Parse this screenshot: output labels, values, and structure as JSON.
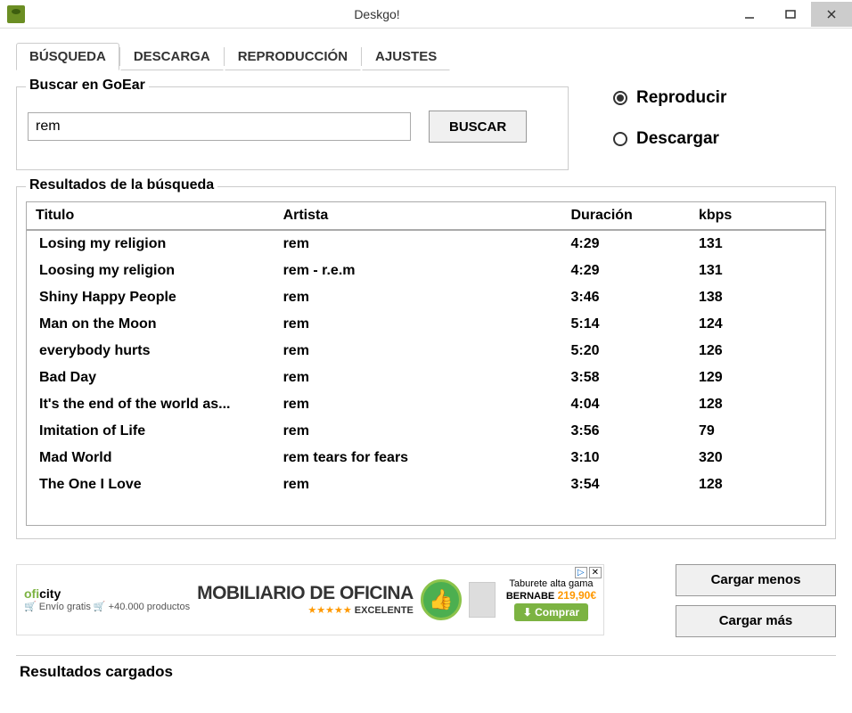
{
  "window": {
    "title": "Deskgo!"
  },
  "tabs": [
    "BÚSQUEDA",
    "DESCARGA",
    "REPRODUCCIÓN",
    "AJUSTES"
  ],
  "search": {
    "legend": "Buscar en GoEar",
    "value": "rem",
    "button": "BUSCAR"
  },
  "action": {
    "play": "Reproducir",
    "download": "Descargar",
    "selected": "play"
  },
  "results": {
    "legend": "Resultados de la búsqueda",
    "headers": {
      "title": "Titulo",
      "artist": "Artista",
      "duration": "Duración",
      "kbps": "kbps"
    },
    "rows": [
      {
        "title": "Losing my religion",
        "artist": "rem",
        "duration": "4:29",
        "kbps": "131"
      },
      {
        "title": "Loosing my religion",
        "artist": "rem - r.e.m",
        "duration": "4:29",
        "kbps": "131"
      },
      {
        "title": "Shiny Happy People",
        "artist": "rem",
        "duration": "3:46",
        "kbps": "138"
      },
      {
        "title": "Man on the Moon",
        "artist": "rem",
        "duration": "5:14",
        "kbps": "124"
      },
      {
        "title": "everybody hurts",
        "artist": "rem",
        "duration": "5:20",
        "kbps": "126"
      },
      {
        "title": "Bad Day",
        "artist": "rem",
        "duration": "3:58",
        "kbps": "129"
      },
      {
        "title": "It's the end of the world as...",
        "artist": "rem",
        "duration": "4:04",
        "kbps": "128"
      },
      {
        "title": "Imitation of Life",
        "artist": "rem",
        "duration": "3:56",
        "kbps": "79"
      },
      {
        "title": " Mad World",
        "artist": "rem  tears for fears",
        "duration": "3:10",
        "kbps": "320"
      },
      {
        "title": "The One I Love",
        "artist": "rem",
        "duration": "3:54",
        "kbps": "128"
      }
    ]
  },
  "ad": {
    "brand": "oficity",
    "headline": "MOBILIARIO DE OFICINA",
    "ship": "Envío gratis",
    "products": "+40.000 productos",
    "rating": "EXCELENTE",
    "item": "Taburete alta gama",
    "item2": "BERNABE",
    "price": "219,90€",
    "buy": "Comprar"
  },
  "buttons": {
    "less": "Cargar menos",
    "more": "Cargar más"
  },
  "status": "Resultados cargados"
}
